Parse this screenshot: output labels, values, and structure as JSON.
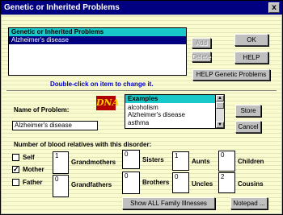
{
  "window": {
    "title": "Genetic or Inherited Problems",
    "close_glyph": "x"
  },
  "problems_list": {
    "header": "Genetic or Inherited Problems",
    "items": [
      "Alzheimer's disease"
    ]
  },
  "buttons": {
    "add": "Add",
    "delete": "Delete",
    "ok": "OK",
    "help": "HELP",
    "help_genetic": "HELP Genetic Problems",
    "store": "Store",
    "cancel": "Cancel",
    "show_all": "Show ALL Family Illnesses",
    "notepad": "Notepad ..."
  },
  "hint": "Double-click on item to change it.",
  "name_of_problem": {
    "label": "Name of Problem:",
    "value": "Alzheimer's disease"
  },
  "logo": {
    "text": "DNA"
  },
  "examples": {
    "header": "Examples",
    "items": [
      "alcoholism",
      "Alzheimer's disease",
      "asthma"
    ]
  },
  "relatives": {
    "label": "Number of blood relatives with this disorder:",
    "self_label": "Self",
    "mother_label": "Mother",
    "father_label": "Father",
    "self_checked": false,
    "mother_checked": true,
    "father_checked": false,
    "checkmark": "✓",
    "grandmothers_label": "Grandmothers",
    "grandmothers": "1",
    "grandfathers_label": "Grandfathers",
    "grandfathers": "0",
    "sisters_label": "Sisters",
    "sisters": "0",
    "brothers_label": "Brothers",
    "brothers": "0",
    "aunts_label": "Aunts",
    "aunts": "1",
    "uncles_label": "Uncles",
    "uncles": "0",
    "children_label": "Children",
    "children": "0",
    "cousins_label": "Cousins",
    "cousins": "2"
  }
}
